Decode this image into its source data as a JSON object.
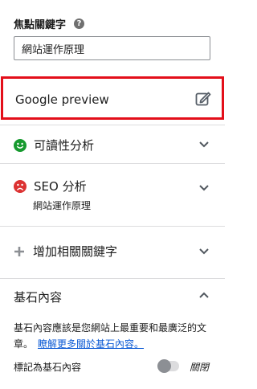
{
  "focus_keyphrase": {
    "label": "焦點關鍵字",
    "help_icon": "question-mark-icon",
    "value": "網站運作原理"
  },
  "google_preview": {
    "label": "Google preview",
    "icon": "edit-icon",
    "highlight_color": "#e30f1a"
  },
  "readability": {
    "label": "可讀性分析",
    "status_icon": "smiley-face-icon",
    "status_color": "#179a2f"
  },
  "seo": {
    "label": "SEO 分析",
    "sublabel": "網站運作原理",
    "status_icon": "sad-face-icon",
    "status_color": "#dc3232"
  },
  "related_keyphrase": {
    "label": "增加相關關鍵字",
    "icon": "plus-icon"
  },
  "cornerstone": {
    "title": "基石內容",
    "description": "基石內容應該是您網站上最重要和最廣泛的文章。",
    "link_text": "瞭解更多關於基石內容。",
    "toggle_label": "標記為基石內容",
    "toggle_state": "關閉",
    "toggle_on": false
  }
}
